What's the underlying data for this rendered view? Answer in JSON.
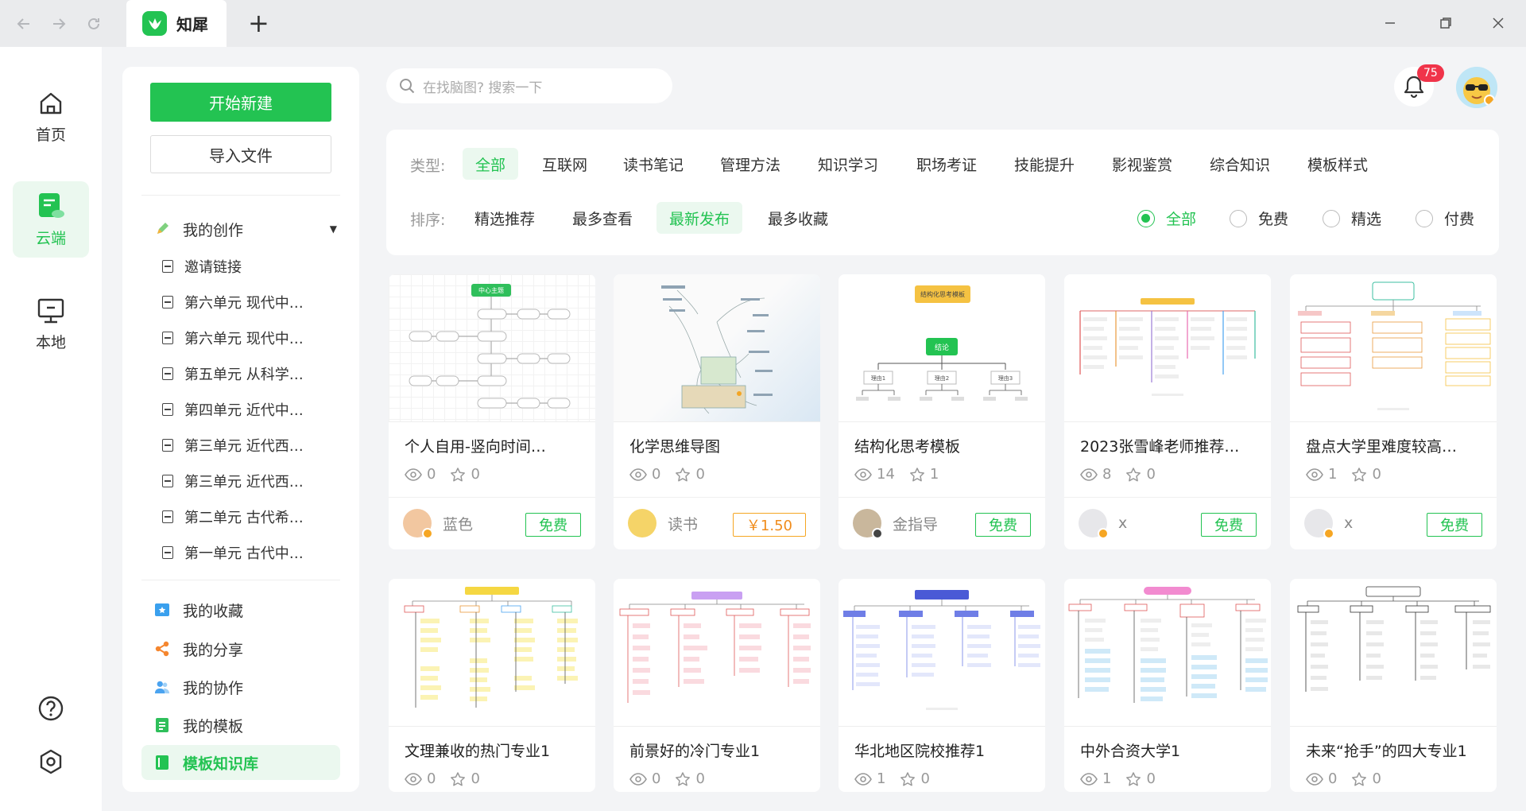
{
  "titlebar": {
    "tab_title": "知犀",
    "new_tab": "+",
    "back_icon": "arrow-left-icon",
    "forward_icon": "arrow-right-icon",
    "reload_icon": "reload-icon",
    "minimize": "—",
    "restore": "❐",
    "close": "✕"
  },
  "rail": {
    "home": "首页",
    "cloud": "云端",
    "local": "本地"
  },
  "sidebar": {
    "new_button": "开始新建",
    "import_button": "导入文件",
    "my_creations": "我的创作",
    "docs": [
      "邀请链接",
      "第六单元 现代中…",
      "第六单元 现代中…",
      "第五单元 从科学…",
      "第四单元 近代中…",
      "第三单元 近代西…",
      "第三单元 近代西…",
      "第二单元 古代希…",
      "第一单元 古代中…"
    ],
    "menu": {
      "favorites": "我的收藏",
      "shares": "我的分享",
      "collab": "我的协作",
      "templates": "我的模板",
      "library": "模板知识库"
    }
  },
  "search": {
    "placeholder": "在找脑图? 搜索一下"
  },
  "notifications": {
    "count": "75"
  },
  "filters": {
    "type_label": "类型:",
    "types": [
      "全部",
      "互联网",
      "读书笔记",
      "管理方法",
      "知识学习",
      "职场考证",
      "技能提升",
      "影视鉴赏",
      "综合知识",
      "模板样式"
    ],
    "selected_type": "全部",
    "sort_label": "排序:",
    "sorts": [
      "精选推荐",
      "最多查看",
      "最新发布",
      "最多收藏"
    ],
    "selected_sort": "最新发布",
    "price_options": [
      "全部",
      "免费",
      "精选",
      "付费"
    ],
    "selected_price": "全部"
  },
  "cards": [
    {
      "title": "个人自用-竖向时间…",
      "views": "0",
      "stars": "0",
      "author": "蓝色",
      "price": "免费"
    },
    {
      "title": "化学思维导图",
      "views": "0",
      "stars": "0",
      "author": "读书",
      "price": "￥1.50"
    },
    {
      "title": "结构化思考模板",
      "views": "14",
      "stars": "1",
      "author": "金指导",
      "price": "免费"
    },
    {
      "title": "2023张雪峰老师推荐…",
      "views": "8",
      "stars": "0",
      "author": "x",
      "price": "免费"
    },
    {
      "title": "盘点大学里难度较高…",
      "views": "1",
      "stars": "0",
      "author": "x",
      "price": "免费"
    },
    {
      "title": "文理兼收的热门专业1",
      "views": "0",
      "stars": "0"
    },
    {
      "title": "前景好的冷门专业1",
      "views": "0",
      "stars": "0"
    },
    {
      "title": "华北地区院校推荐1",
      "views": "1",
      "stars": "0"
    },
    {
      "title": "中外合资大学1",
      "views": "1",
      "stars": "0"
    },
    {
      "title": "未来“抢手”的四大专业1",
      "views": "0",
      "stars": "0"
    }
  ],
  "thumb_labels": {
    "center_topic": "中心主题",
    "structured": "结构化思考模板",
    "conclusion": "结论",
    "reasons": [
      "理由1",
      "理由2",
      "理由3"
    ]
  },
  "colors": {
    "brand_green": "#23c352",
    "badge_red": "#f0344a",
    "paid_orange": "#f08c1c"
  }
}
